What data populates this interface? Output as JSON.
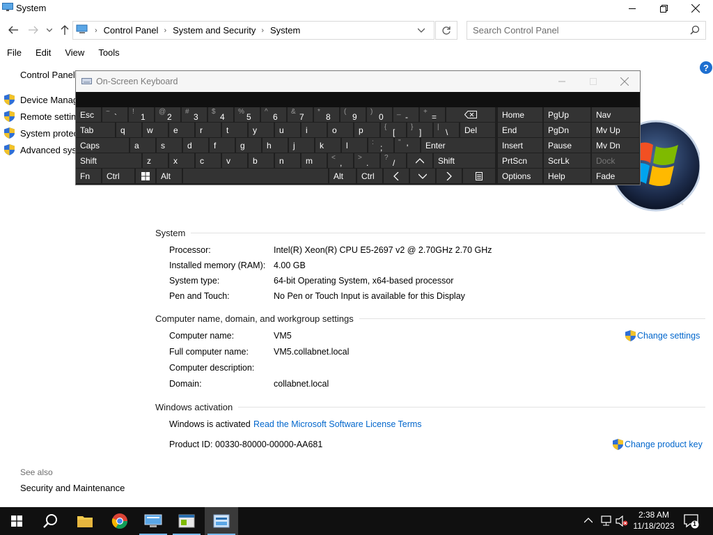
{
  "window": {
    "title": "System"
  },
  "address": {
    "breadcrumbs": [
      "Control Panel",
      "System and Security",
      "System"
    ],
    "search_placeholder": "Search Control Panel"
  },
  "menu": [
    "File",
    "Edit",
    "View",
    "Tools"
  ],
  "left_pane": {
    "home": "Control Panel H",
    "links": [
      "Device Manage",
      "Remote setting",
      "System protect",
      "Advanced syste"
    ],
    "see_also": "See also",
    "security_maintenance": "Security and Maintenance"
  },
  "system": {
    "heading": "System",
    "rows": [
      {
        "label": "Processor:",
        "value": "Intel(R) Xeon(R) CPU E5-2697 v2 @ 2.70GHz   2.70 GHz"
      },
      {
        "label": "Installed memory (RAM):",
        "value": "4.00 GB"
      },
      {
        "label": "System type:",
        "value": "64-bit Operating System, x64-based processor"
      },
      {
        "label": "Pen and Touch:",
        "value": "No Pen or Touch Input is available for this Display"
      }
    ]
  },
  "computer": {
    "heading": "Computer name, domain, and workgroup settings",
    "change_settings": "Change settings",
    "rows": [
      {
        "label": "Computer name:",
        "value": "VM5"
      },
      {
        "label": "Full computer name:",
        "value": "VM5.collabnet.local"
      },
      {
        "label": "Computer description:",
        "value": ""
      },
      {
        "label": "Domain:",
        "value": "collabnet.local"
      }
    ]
  },
  "activation": {
    "heading": "Windows activation",
    "status": "Windows is activated",
    "license_link": "Read the Microsoft Software License Terms",
    "product_id": "Product ID:  00330-80000-00000-AA681",
    "change_product_key": "Change product key"
  },
  "osk": {
    "title": "On-Screen Keyboard",
    "nav_keys": {
      "home": "Home",
      "pgup": "PgUp",
      "nav": "Nav",
      "end": "End",
      "pgdn": "PgDn",
      "mvup": "Mv Up",
      "insert": "Insert",
      "pause": "Pause",
      "mvdn": "Mv Dn",
      "prtscn": "PrtScn",
      "scrlk": "ScrLk",
      "dock": "Dock",
      "options": "Options",
      "help": "Help",
      "fade": "Fade"
    },
    "keys": {
      "esc": "Esc",
      "tab": "Tab",
      "caps": "Caps",
      "shift": "Shift",
      "shift_r": "Shift",
      "fn": "Fn",
      "ctrl": "Ctrl",
      "alt": "Alt",
      "alt_r": "Alt",
      "ctrl_r": "Ctrl",
      "del": "Del",
      "enter": "Enter",
      "row1": [
        {
          "s": "~",
          "m": "`"
        },
        {
          "s": "!",
          "m": "1"
        },
        {
          "s": "@",
          "m": "2"
        },
        {
          "s": "#",
          "m": "3"
        },
        {
          "s": "$",
          "m": "4"
        },
        {
          "s": "%",
          "m": "5"
        },
        {
          "s": "^",
          "m": "6"
        },
        {
          "s": "&",
          "m": "7"
        },
        {
          "s": "*",
          "m": "8"
        },
        {
          "s": "(",
          "m": "9"
        },
        {
          "s": ")",
          "m": "0"
        },
        {
          "s": "_",
          "m": "-"
        },
        {
          "s": "+",
          "m": "="
        }
      ],
      "row2": [
        "q",
        "w",
        "e",
        "r",
        "t",
        "y",
        "u",
        "i",
        "o",
        "p"
      ],
      "row2_extra": [
        {
          "s": "{",
          "m": "["
        },
        {
          "s": "}",
          "m": "]"
        },
        {
          "s": "|",
          "m": "\\"
        }
      ],
      "row3": [
        "a",
        "s",
        "d",
        "f",
        "g",
        "h",
        "j",
        "k",
        "l"
      ],
      "row3_extra": [
        {
          "s": ":",
          "m": ";"
        },
        {
          "s": "\"",
          "m": "'"
        }
      ],
      "row4": [
        "z",
        "x",
        "c",
        "v",
        "b",
        "n",
        "m"
      ],
      "row4_extra": [
        {
          "s": "<",
          "m": ","
        },
        {
          "s": ">",
          "m": "."
        },
        {
          "s": "?",
          "m": "/"
        }
      ]
    }
  },
  "taskbar": {
    "time": "2:38 AM",
    "date": "11/18/2023",
    "notification_count": "1"
  }
}
